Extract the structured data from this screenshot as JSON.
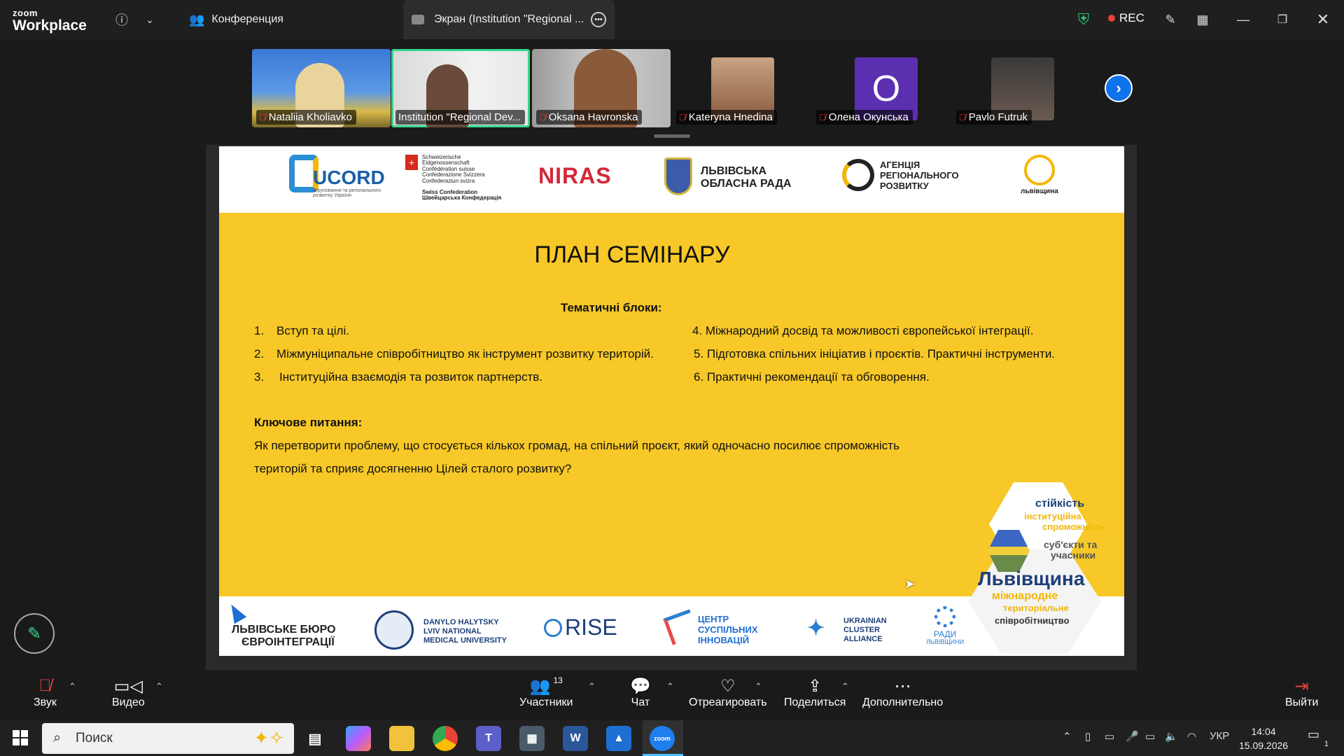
{
  "window": {
    "brand_top": "zoom",
    "brand_bottom": "Workplace",
    "tab_conference": "Конференция",
    "tab_screen": "Экран (Institution \"Regional ...",
    "rec_label": "REC"
  },
  "participants": [
    {
      "name": "Nataliia Kholiavko",
      "muted": true
    },
    {
      "name": "Institution \"Regional Dev...",
      "muted": false
    },
    {
      "name": "Oksana Havronska",
      "muted": true
    },
    {
      "name": "Kateryna Hnedina",
      "muted": true
    },
    {
      "name": "Олена Окунська",
      "muted": true,
      "initial": "O"
    },
    {
      "name": "Pavlo Futruk",
      "muted": true
    }
  ],
  "slide": {
    "top_logos": {
      "ucord": "UCORD",
      "ucord_sub": "Угруповання та регіонального розвитку України",
      "swiss_1": "Schweizerische Eidgenossenschaft",
      "swiss_2": "Confédération suisse",
      "swiss_3": "Confederazione Svizzera",
      "swiss_4": "Confederaziun svizra",
      "swiss_5": "Swiss Confederation",
      "swiss_6": "Швейцарська Конфедерація",
      "niras": "NIRAS",
      "lviv_rada_1": "ЛЬВІВСЬКА",
      "lviv_rada_2": "ОБЛАСНА РАДА",
      "agency_1": "АГЕНЦІЯ",
      "agency_2": "РЕГІОНАЛЬНОГО",
      "agency_3": "РОЗВИТКУ",
      "lvivshchyna": "львівщина"
    },
    "title": "ПЛАН СЕМІНАРУ",
    "blocks_heading": "Тематичні блоки:",
    "left_items": [
      {
        "num": "1.",
        "text": "Вступ та цілі."
      },
      {
        "num": "2.",
        "text": "Міжмуніципальне співробітництво як інструмент розвитку територій."
      },
      {
        "num": "3.",
        "text": "Інституційна взаємодія та розвиток партнерств."
      }
    ],
    "right_items": [
      "4. Міжнародний досвід та можливості європейської інтеграції.",
      "5. Підготовка спільних ініціатив і проєктів. Практичні інструменти.",
      "6. Практичні рекомендації та обговорення."
    ],
    "key_question_label": "Ключове питання:",
    "key_question_line1": "Як перетворити проблему, що стосується кількох громад, на спільний проєкт, який одночасно посилює спроможність",
    "key_question_line2": "територій та сприяє досягненню Цілей сталого розвитку?",
    "hex_words": {
      "w1": "стійкість",
      "w2": "інституційна",
      "w3": "спроможність",
      "w4": "суб'єкти та",
      "w5": "учасники",
      "w6": "Львівщина",
      "w7": "міжнародне",
      "w8": "територіальне",
      "w9": "співробітництво"
    },
    "bottom_logos": {
      "lbe_1": "ЛЬВІВСЬКЕ БЮРО",
      "lbe_2": "ЄВРОІНТЕГРАЦІЇ",
      "uni_1": "DANYLO HALYTSKY",
      "uni_2": "LVIV NATIONAL",
      "uni_3": "MEDICAL UNIVERSITY",
      "rise": "RISE",
      "csi_1": "ЦЕНТР",
      "csi_2": "СУСПІЛЬНИХ",
      "csi_3": "ІННОВАЦІЙ",
      "uca_1": "UKRAINIAN",
      "uca_2": "CLUSTER",
      "uca_3": "ALLIANCE",
      "rady_1": "РАДИ",
      "rady_2": "ЛЬВІВЩИНИ"
    }
  },
  "toolbar": {
    "audio": "Звук",
    "video": "Видео",
    "participants": "Участники",
    "participants_count": "13",
    "chat": "Чат",
    "react": "Отреагировать",
    "share": "Поделиться",
    "more": "Дополнительно",
    "leave": "Выйти"
  },
  "taskbar": {
    "search_placeholder": "Поиск",
    "language": "УКР",
    "time": "14:04",
    "date": "15.09.2026",
    "notifications": "1"
  },
  "colors": {
    "accent_green": "#37d68b",
    "slide_yellow": "#f7c827",
    "zoom_blue": "#0e72ed",
    "rec_red": "#e8413c"
  }
}
